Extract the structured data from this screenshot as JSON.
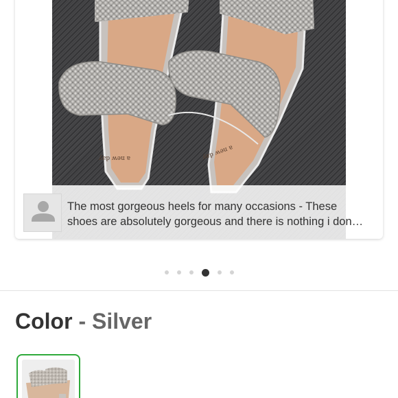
{
  "review": {
    "text_line1": "The most gorgeous heels for many occasions - These",
    "text_line2": "shoes are absolutely gorgeous and there is nothing i don…",
    "insole_brand": "a new day"
  },
  "carousel": {
    "dot_count": 6,
    "active_index": 3
  },
  "color": {
    "label": "Color",
    "separator": "-",
    "value": "Silver"
  },
  "colors": {
    "selected_border": "#2eaa3a",
    "active_dot": "#333333"
  }
}
